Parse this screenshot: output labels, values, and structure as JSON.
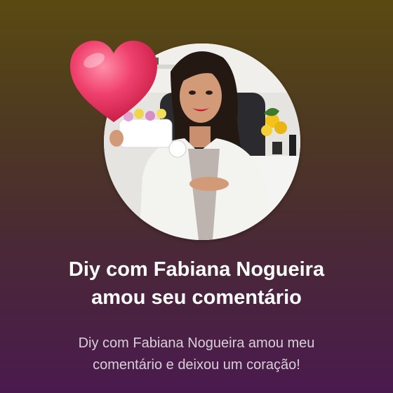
{
  "notification": {
    "title_line1": "Diy com Fabiana Nogueira",
    "title_line2": "amou seu comentário",
    "message_line1": "Diy com Fabiana Nogueira amou meu",
    "message_line2": "comentário e deixou um coração!"
  },
  "icons": {
    "heart": "heart-icon"
  },
  "colors": {
    "heart": "#f0416e",
    "title_text": "#ffffff",
    "message_text": "#d9cfd8"
  }
}
